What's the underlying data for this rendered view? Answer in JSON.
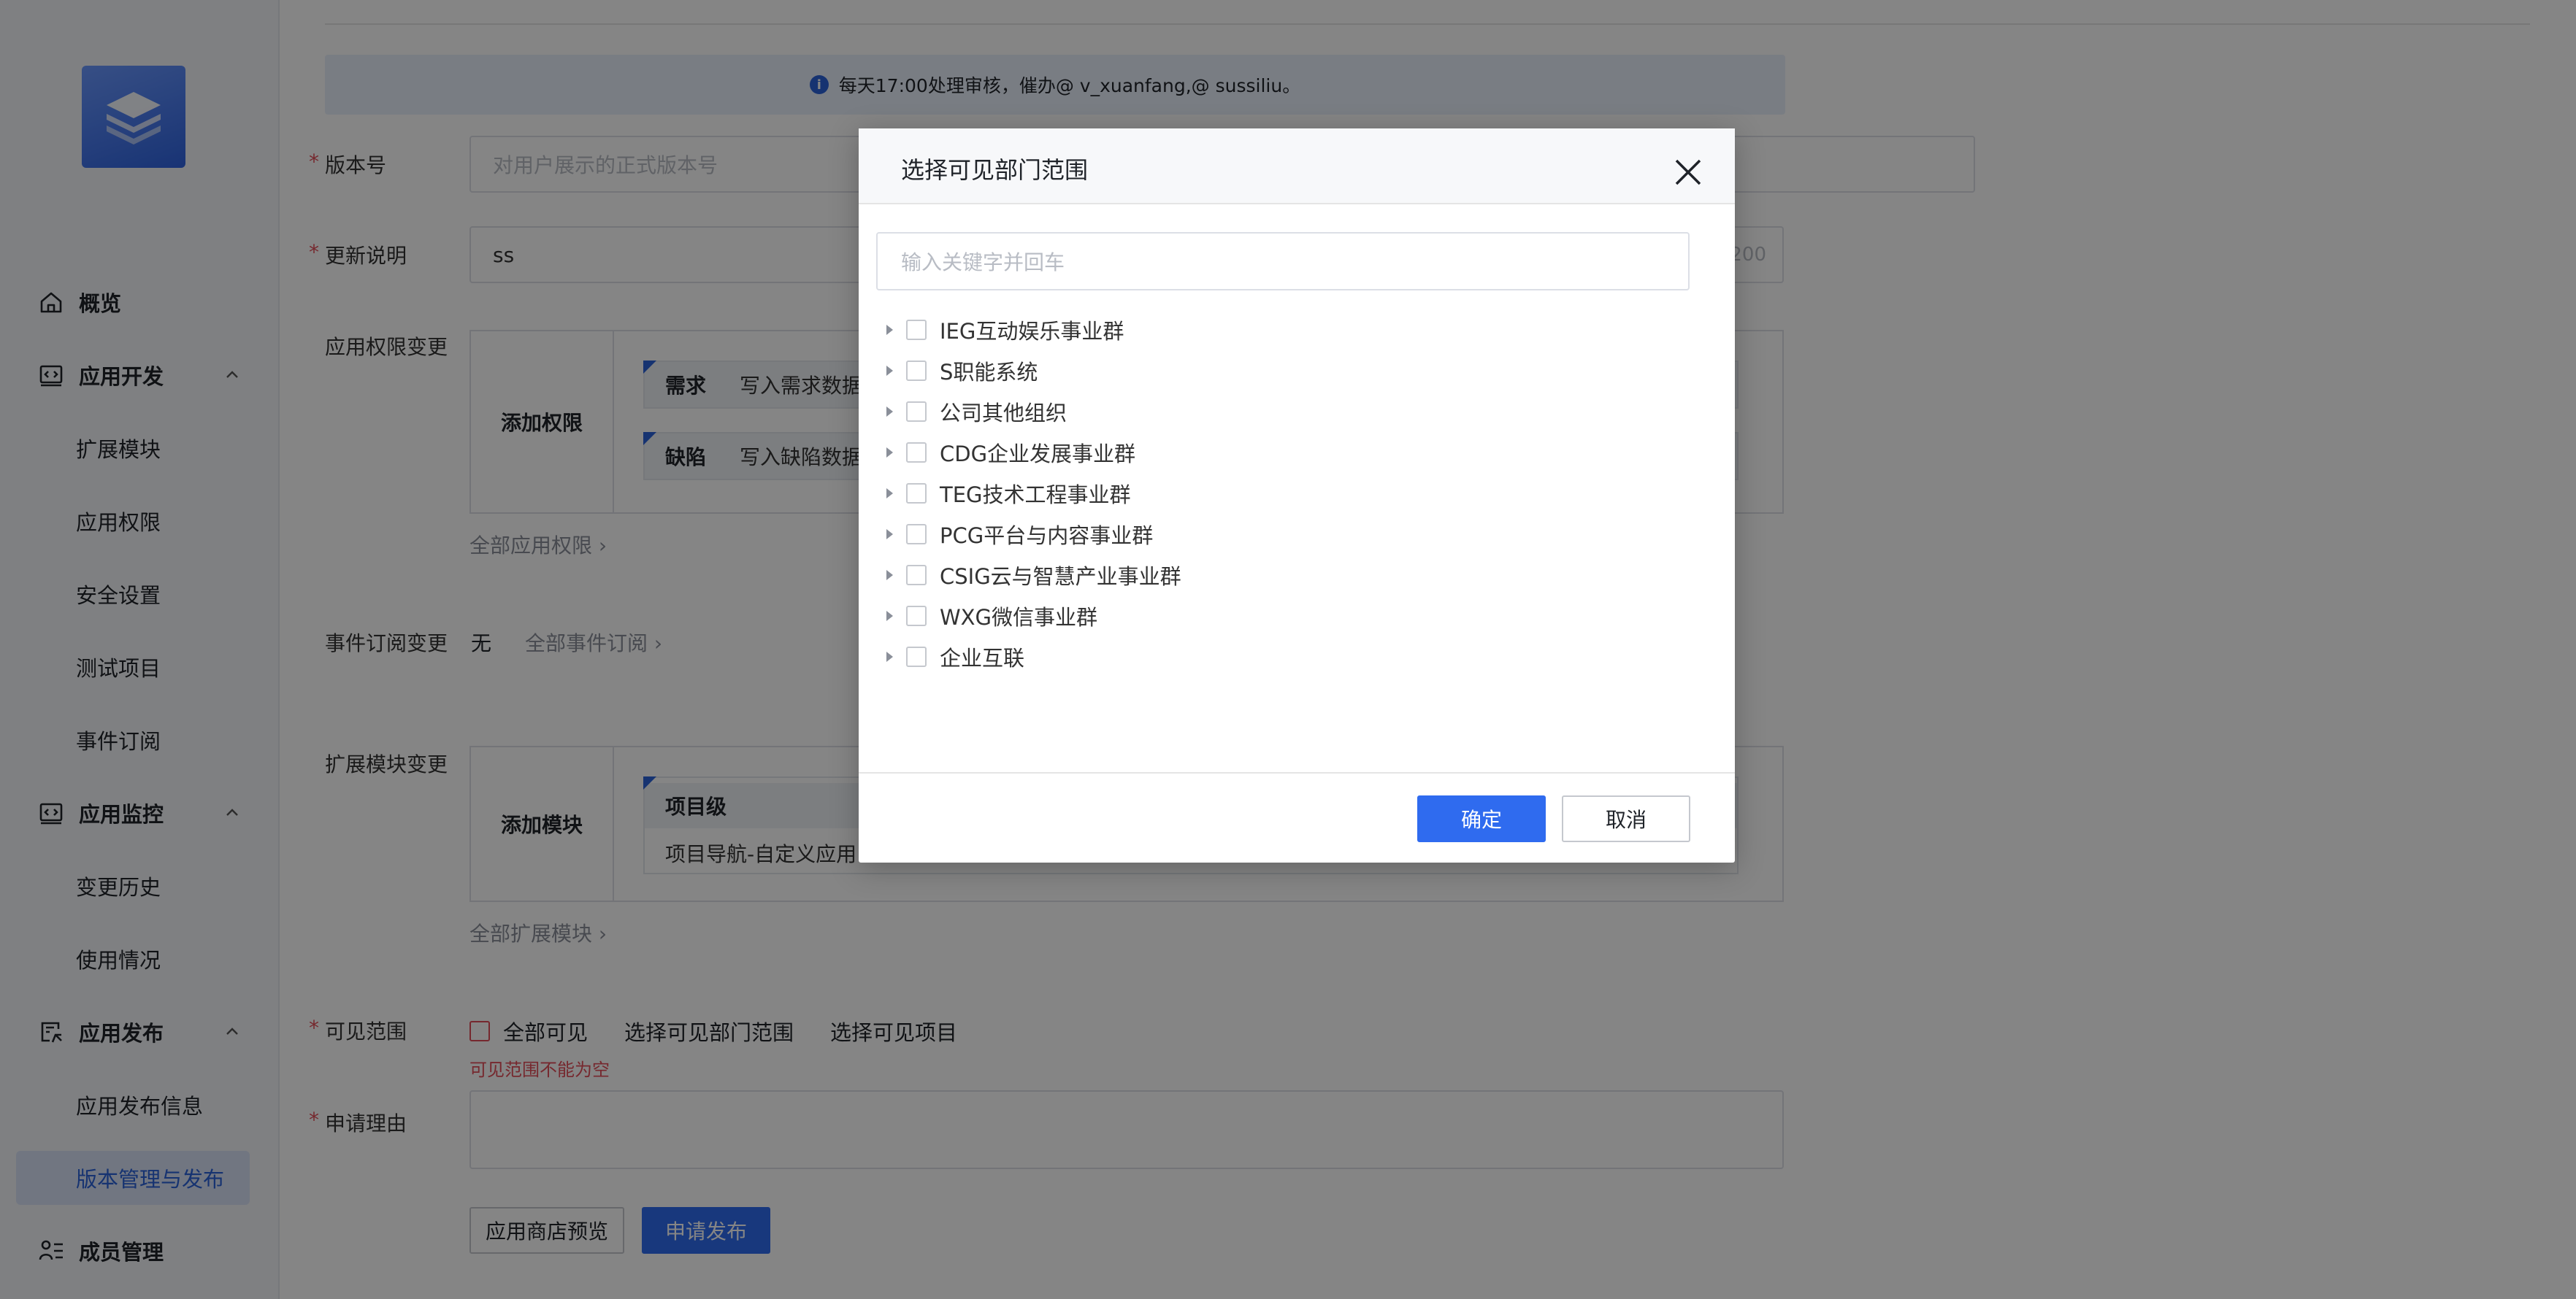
{
  "notice": {
    "icon": "info-icon",
    "text": "每天17:00处理审核，催办@ v_xuanfang,@ sussiliu。"
  },
  "sidebar": {
    "logo_icon": "layers-icon",
    "items": [
      {
        "label": "概览",
        "icon": "home-icon",
        "level": "top"
      },
      {
        "label": "应用开发",
        "icon": "code-window-icon",
        "level": "top",
        "expanded": true
      },
      {
        "label": "扩展模块",
        "level": "sub"
      },
      {
        "label": "应用权限",
        "level": "sub"
      },
      {
        "label": "安全设置",
        "level": "sub"
      },
      {
        "label": "测试项目",
        "level": "sub"
      },
      {
        "label": "事件订阅",
        "level": "sub"
      },
      {
        "label": "应用监控",
        "icon": "monitor-icon",
        "level": "top",
        "expanded": true
      },
      {
        "label": "变更历史",
        "level": "sub"
      },
      {
        "label": "使用情况",
        "level": "sub"
      },
      {
        "label": "应用发布",
        "icon": "publish-icon",
        "level": "top",
        "expanded": true
      },
      {
        "label": "应用发布信息",
        "level": "sub"
      },
      {
        "label": "版本管理与发布",
        "level": "sub",
        "active": true
      },
      {
        "label": "成员管理",
        "icon": "members-icon",
        "level": "top"
      }
    ]
  },
  "form": {
    "version": {
      "label": "版本号",
      "placeholder": "对用户展示的正式版本号"
    },
    "update_notes": {
      "label": "更新说明",
      "value": "ss",
      "counter": "/200"
    },
    "permission_change": {
      "label": "应用权限变更",
      "add_label": "添加权限",
      "rows": [
        {
          "key": "需求",
          "value": "写入需求数据"
        },
        {
          "key": "缺陷",
          "value": "写入缺陷数据"
        }
      ],
      "more_link": "全部应用权限"
    },
    "event_change": {
      "label": "事件订阅变更",
      "value": "无",
      "more_link": "全部事件订阅"
    },
    "module_change": {
      "label": "扩展模块变更",
      "add_label": "添加模块",
      "header": "项目级",
      "row_value": "项目导航-自定义应用",
      "more_link": "全部扩展模块"
    },
    "visibility": {
      "label": "可见范围",
      "all_label": "全部可见",
      "dept_option": "选择可见部门范围",
      "project_option": "选择可见项目",
      "error": "可见范围不能为空"
    },
    "reason": {
      "label": "申请理由"
    },
    "preview_button": "应用商店预览",
    "submit_button": "申请发布"
  },
  "dialog": {
    "title": "选择可见部门范围",
    "search_placeholder": "输入关键字并回车",
    "tree": [
      "IEG互动娱乐事业群",
      "S职能系统",
      "公司其他组织",
      "CDG企业发展事业群",
      "TEG技术工程事业群",
      "PCG平台与内容事业群",
      "CSIG云与智慧产业事业群",
      "WXG微信事业群",
      "企业互联"
    ],
    "confirm_label": "确定",
    "cancel_label": "取消"
  },
  "colors": {
    "primary": "#2f6bef",
    "error": "#e34d59",
    "active_bg": "#d9e3f8"
  }
}
